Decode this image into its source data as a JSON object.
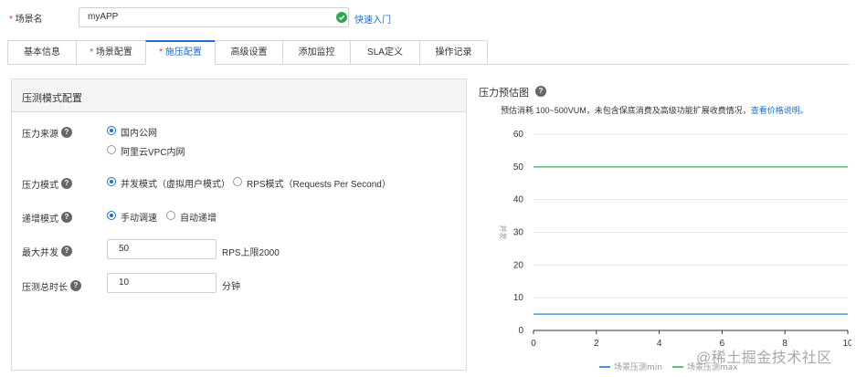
{
  "scene": {
    "required_mark": "*",
    "label": "场景名",
    "value": "myAPP",
    "link": "快速入门"
  },
  "tabs": [
    {
      "label": "基本信息",
      "required": false,
      "active": false
    },
    {
      "label": "场景配置",
      "required": true,
      "active": false
    },
    {
      "label": "施压配置",
      "required": true,
      "active": true
    },
    {
      "label": "高级设置",
      "required": false,
      "active": false
    },
    {
      "label": "添加监控",
      "required": false,
      "active": false
    },
    {
      "label": "SLA定义",
      "required": false,
      "active": false
    },
    {
      "label": "操作记录",
      "required": false,
      "active": false
    }
  ],
  "panel": {
    "title": "压测模式配置",
    "source": {
      "label": "压力来源",
      "options": [
        "国内公网",
        "阿里云VPC内网"
      ],
      "selected": 0
    },
    "mode": {
      "label": "压力模式",
      "options": [
        "并发模式（虚拟用户模式）",
        "RPS模式（Requests Per Second）"
      ],
      "selected": 0
    },
    "ramp": {
      "label": "递增模式",
      "options": [
        "手动调速",
        "自动递增"
      ],
      "selected": 0
    },
    "max_concurrency": {
      "label": "最大并发",
      "value": "50",
      "hint": "RPS上限2000"
    },
    "duration": {
      "label": "压测总时长",
      "value": "10",
      "unit": "分钟"
    },
    "help_glyph": "?"
  },
  "estimate": {
    "title": "压力预估图",
    "note": "预估消耗 100~500VUM，未包含保底消费及高级功能扩展收费情况，",
    "link": "查看价格说明。"
  },
  "chart_data": {
    "type": "line",
    "ylabel": "并发",
    "xlim": [
      0,
      10
    ],
    "ylim": [
      0,
      60
    ],
    "x_ticks": [
      "0",
      "2",
      "4",
      "6",
      "8",
      "10"
    ],
    "y_ticks": [
      "0",
      "10",
      "20",
      "30",
      "40",
      "50",
      "60"
    ],
    "grid": "horizontal",
    "legend_position": "bottom",
    "series": [
      {
        "name": "场景压测min",
        "x": [
          0,
          10
        ],
        "values": [
          5,
          5
        ],
        "color": "#4a90e2"
      },
      {
        "name": "场景压测max",
        "x": [
          0,
          10
        ],
        "values": [
          50,
          50
        ],
        "color": "#5cbf6e"
      }
    ]
  },
  "watermark": "@稀土掘金技术社区",
  "colors": {
    "accent": "#1a6fd0",
    "required": "#e5393d",
    "success": "#2fa84f"
  }
}
